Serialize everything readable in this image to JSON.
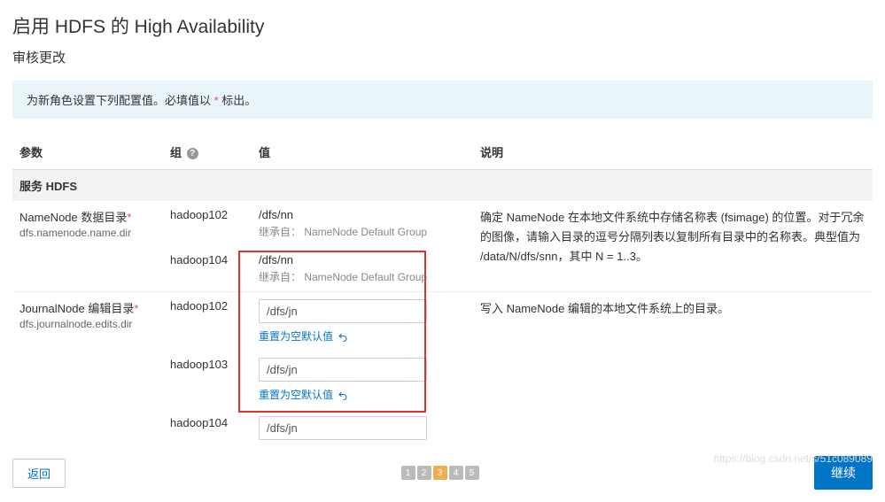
{
  "title": "启用 HDFS 的 High Availability",
  "subtitle": "审核更改",
  "alert": {
    "prefix": "为新角色设置下列配置值。必填值以 ",
    "star": "*",
    "suffix": " 标出。"
  },
  "headers": {
    "param": "参数",
    "group": "组",
    "help": "?",
    "value": "值",
    "desc": "说明"
  },
  "service_row": "服务 HDFS",
  "rows": {
    "nn": {
      "label": "NameNode 数据目录",
      "key": "dfs.namenode.name.dir",
      "groups": [
        "hadoop102",
        "hadoop104"
      ],
      "values": [
        "/dfs/nn",
        "/dfs/nn"
      ],
      "inherit": "继承自：  NameNode Default Group",
      "desc": "确定 NameNode 在本地文件系统中存储名称表 (fsimage) 的位置。对于冗余的图像，请输入目录的逗号分隔列表以复制所有目录中的名称表。典型值为 /data/N/dfs/snn，其中 N = 1..3。"
    },
    "jn": {
      "label": "JournalNode 编辑目录",
      "key": "dfs.journalnode.edits.dir",
      "groups": [
        "hadoop102",
        "hadoop103",
        "hadoop104"
      ],
      "values": [
        "/dfs/jn",
        "/dfs/jn",
        "/dfs/jn"
      ],
      "reset": "重置为空默认值",
      "desc": "写入 NameNode 编辑的本地文件系统上的目录。"
    }
  },
  "footer": {
    "back": "返回",
    "continue": "继续"
  },
  "pager": [
    "1",
    "2",
    "3",
    "4",
    "5"
  ],
  "watermark": "https://blog.csdn.net/s/51c089089"
}
